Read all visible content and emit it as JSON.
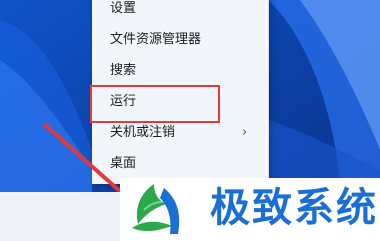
{
  "menu": {
    "items": [
      {
        "label": "设置"
      },
      {
        "label": "文件资源管理器"
      },
      {
        "label": "搜索"
      },
      {
        "label": "运行"
      },
      {
        "label": "关机或注销",
        "has_submenu": true
      },
      {
        "label": "桌面"
      }
    ],
    "submenu_chevron": "›"
  },
  "watermark": {
    "text": "极致系统"
  },
  "colors": {
    "highlight_border": "#e03a3a",
    "watermark_text": "#1a6fd6",
    "wallpaper": "#0a3fa8"
  }
}
